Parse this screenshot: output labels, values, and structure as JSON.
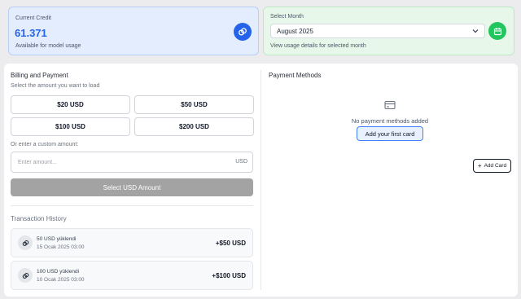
{
  "credit": {
    "label": "Current Credit",
    "value": "61.371",
    "subtitle": "Available for model usage",
    "icon": "coins-icon",
    "accent": "#2563eb"
  },
  "month": {
    "label": "Select Month",
    "selected": "August 2025",
    "subtitle": "View usage details for selected month",
    "icon": "calendar-icon",
    "accent": "#22c55e"
  },
  "billing": {
    "title": "Billing and Payment",
    "hint": "Select the amount you want to load",
    "amounts": [
      "$20 USD",
      "$50 USD",
      "$100 USD",
      "$200 USD"
    ],
    "custom_label": "Or enter a custom amount:",
    "custom_placeholder": "Enter amount...",
    "currency": "USD",
    "select_button": "Select USD Amount"
  },
  "history": {
    "title": "Transaction History",
    "items": [
      {
        "title": "50 USD yüklendi",
        "date": "15 Ocak 2025 03:00",
        "amount": "+$50 USD"
      },
      {
        "title": "100 USD yüklendi",
        "date": "10 Ocak 2025 03:00",
        "amount": "+$100 USD"
      }
    ]
  },
  "payment_methods": {
    "title": "Payment Methods",
    "empty_text": "No payment methods added",
    "add_first": "Add your first card",
    "add_card": "Add Card"
  }
}
